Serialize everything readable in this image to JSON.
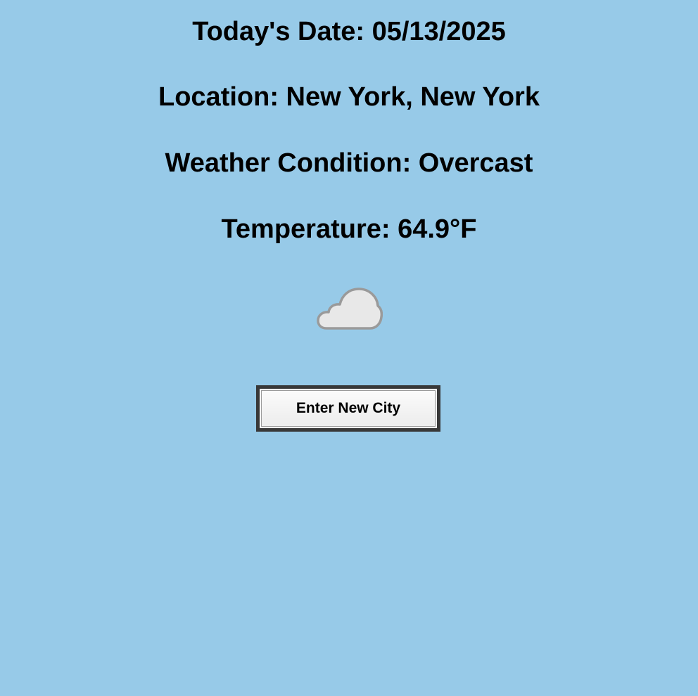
{
  "weather": {
    "date_line": "Today's Date: 05/13/2025",
    "location_line": "Location: New York, New York",
    "condition_line": "Weather Condition: Overcast",
    "temperature_line": "Temperature: 64.9°F",
    "icon": "cloud-icon"
  },
  "actions": {
    "new_city_label": "Enter New City"
  },
  "colors": {
    "background": "#97cae8",
    "button_border": "#383838",
    "cloud_fill": "#e8e8e8",
    "cloud_stroke": "#9a9a9a"
  }
}
